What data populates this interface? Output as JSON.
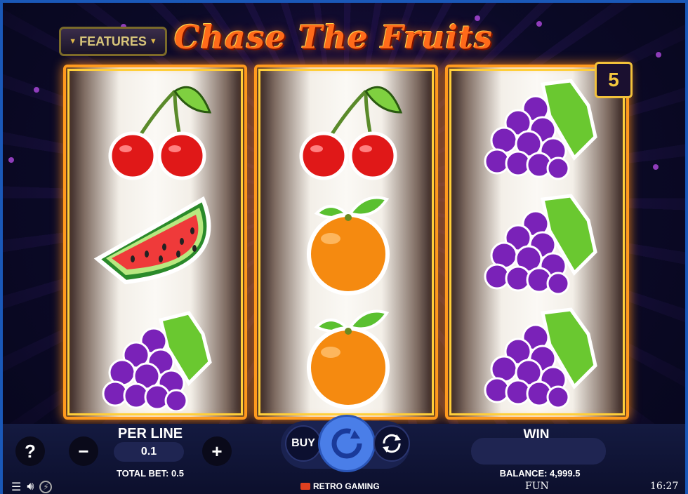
{
  "game": {
    "title": "Chase The Fruits",
    "features_label": "FEATURES",
    "lines_count": "5"
  },
  "reels": [
    [
      "cherry",
      "watermelon",
      "grapes"
    ],
    [
      "cherry",
      "orange",
      "orange"
    ],
    [
      "grapes",
      "grapes",
      "grapes"
    ]
  ],
  "controls": {
    "help_label": "?",
    "minus_label": "−",
    "plus_label": "+",
    "per_line_label": "PER LINE",
    "per_line_value": "0.1",
    "total_bet_label": "TOTAL BET: 0.5",
    "buy_label": "BUY",
    "win_label": "WIN",
    "win_value": "",
    "balance_label": "BALANCE: 4,999.5"
  },
  "footer": {
    "brand": "RETRO GAMING",
    "mode": "FUN",
    "clock": "16:27"
  },
  "colors": {
    "reel_frame": "#ff9a1e",
    "spin_button": "#4a7ee8",
    "badge": "#f4c83e"
  }
}
